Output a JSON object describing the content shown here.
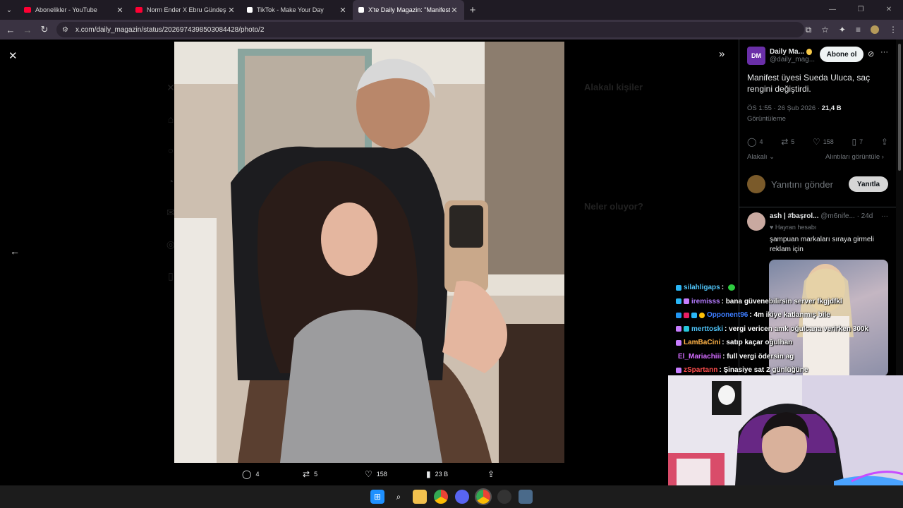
{
  "browser": {
    "tabs": [
      {
        "title": "Abonelikler - YouTube",
        "favicon_color": "#ff0033",
        "active": false
      },
      {
        "title": "Norm Ender X Ebru Gündeş - B",
        "favicon_color": "#ff0033",
        "active": false
      },
      {
        "title": "TikTok - Make Your Day",
        "favicon_color": "#ffffff",
        "active": false
      },
      {
        "title": "X'te Daily Magazin: \"Manifest ü",
        "favicon_color": "#ffffff",
        "active": true
      }
    ],
    "new_tab_label": "+",
    "url": "x.com/daily_magazin/status/2026974398503084428/photo/2"
  },
  "viewer": {
    "close_icon": "✕",
    "prev_icon": "←",
    "expand_icon": "»"
  },
  "photo_actions": {
    "replies": "4",
    "reposts": "5",
    "likes": "158",
    "views": "23 B"
  },
  "tweet": {
    "author_name": "Daily Ma...",
    "author_handle": "@daily_mag...",
    "avatar_text": "DM",
    "follow_label": "Abone ol",
    "text": "Manifest üyesi Sueda Uluca, saç rengini değiştirdi.",
    "time": "ÖS 1:55 · 26 Şub 2026 · ",
    "views_count": "21,4 B",
    "views_label": "Görüntüleme",
    "stats": {
      "replies": "4",
      "reposts": "5",
      "likes": "158",
      "bookmarks": "7"
    },
    "sort_label": "Alakalı",
    "quotes_link": "Alıntıları görüntüle",
    "reply_placeholder": "Yanıtını gönder",
    "reply_button": "Yanıtla"
  },
  "reply": {
    "name": "ash | #başrol...",
    "handle": "@m6nife...",
    "age": "· 24d",
    "fan_label": "Hayran hesabı",
    "text": "şampuan markaları sıraya girmeli reklam için"
  },
  "background_sidebar": {
    "related_heading": "Alakalı kişiler",
    "trending_heading": "Neler oluyor?"
  },
  "chat": [
    {
      "user": "silahligaps",
      "msg": ":",
      "color": "#4fc3f7"
    },
    {
      "user": "iremisss",
      "msg": ": bana güvenebilirsin server fkgjdfkl",
      "color": "#b57bff"
    },
    {
      "user": "Opponent96",
      "msg": ": 4m ikiye katlanmış bile",
      "color": "#3d7dff"
    },
    {
      "user": "merttoski",
      "msg": ": vergi vericen amk oğulcana verirken 300k",
      "color": "#4fc3f7"
    },
    {
      "user": "LamBaCini",
      "msg": ": satıp kaçar oğulhan",
      "color": "#ffb347"
    },
    {
      "user": "El_Mariachiii",
      "msg": ": full vergi ödersin ag",
      "color": "#d46bff"
    },
    {
      "user": "zSpartann",
      "msg": ": Şinasiye sat 2 günlüğüne",
      "color": "#ff4d4d"
    }
  ]
}
